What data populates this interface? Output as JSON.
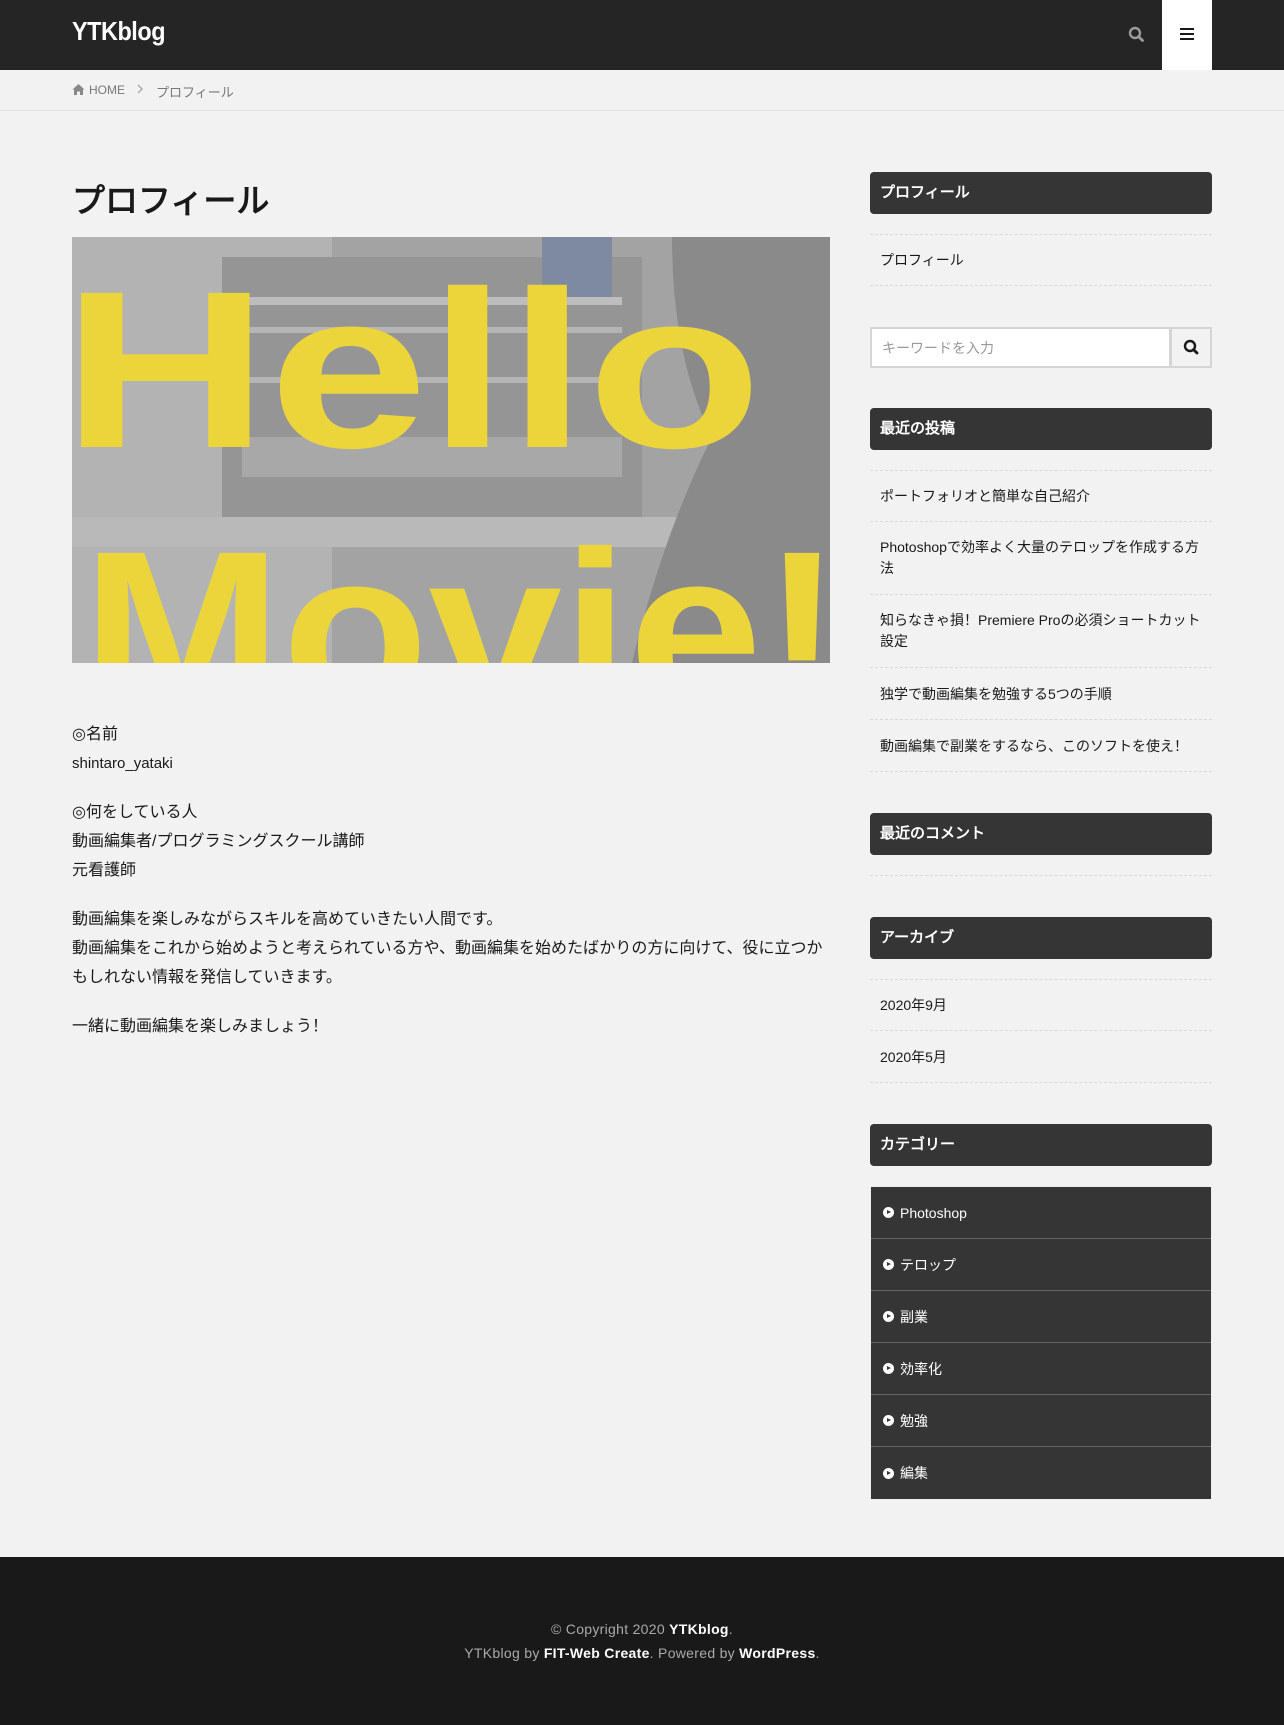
{
  "header": {
    "logo": "YTKblog",
    "search_icon": "search-icon",
    "menu_icon": "hamburger-menu-icon"
  },
  "breadcrumb": {
    "home": "HOME",
    "current": "プロフィール"
  },
  "main": {
    "title": "プロフィール",
    "hero": {
      "line1": "Hello",
      "line2": "Movie!"
    },
    "name_heading": "◎名前",
    "name_value": "shintaro_yataki",
    "role_heading": "◎何をしている人",
    "role_line1": "動画編集者/プログラミングスクール講師",
    "role_line2": "元看護師",
    "intro_line1": "動画編集を楽しみながらスキルを高めていきたい人間です。",
    "intro_line2": "動画編集をこれから始めようと考えられている方や、動画編集を始めたばかりの方に向けて、役に立つかもしれない情報を発信していきます。",
    "closing": "一緒に動画編集を楽しみましょう！"
  },
  "sidebar": {
    "profile": {
      "title": "プロフィール",
      "items": [
        "プロフィール"
      ]
    },
    "search": {
      "placeholder": "キーワードを入力"
    },
    "recent_posts": {
      "title": "最近の投稿",
      "items": [
        "ポートフォリオと簡単な自己紹介",
        "Photoshopで効率よく大量のテロップを作成する方法",
        "知らなきゃ損！Premiere Proの必須ショートカット設定",
        "独学で動画編集を勉強する5つの手順",
        "動画編集で副業をするなら、このソフトを使え！"
      ]
    },
    "recent_comments": {
      "title": "最近のコメント"
    },
    "archives": {
      "title": "アーカイブ",
      "items": [
        "2020年9月",
        "2020年5月"
      ]
    },
    "categories": {
      "title": "カテゴリー",
      "items": [
        "Photoshop",
        "テロップ",
        "副業",
        "効率化",
        "勉強",
        "編集"
      ]
    }
  },
  "footer": {
    "copyright_prefix": "© Copyright 2020 ",
    "copyright_site": "YTKblog",
    "copyright_suffix": ".",
    "credit_prefix": "YTKblog by ",
    "credit_theme": "FIT-Web Create",
    "credit_middle": ". Powered by ",
    "credit_cms": "WordPress",
    "credit_suffix": "."
  },
  "colors": {
    "header_bg": "#252525",
    "page_bg": "#f2f2f2",
    "widget_title_bg": "#353535",
    "footer_bg": "#191919",
    "hero_text": "#ecd53a"
  }
}
